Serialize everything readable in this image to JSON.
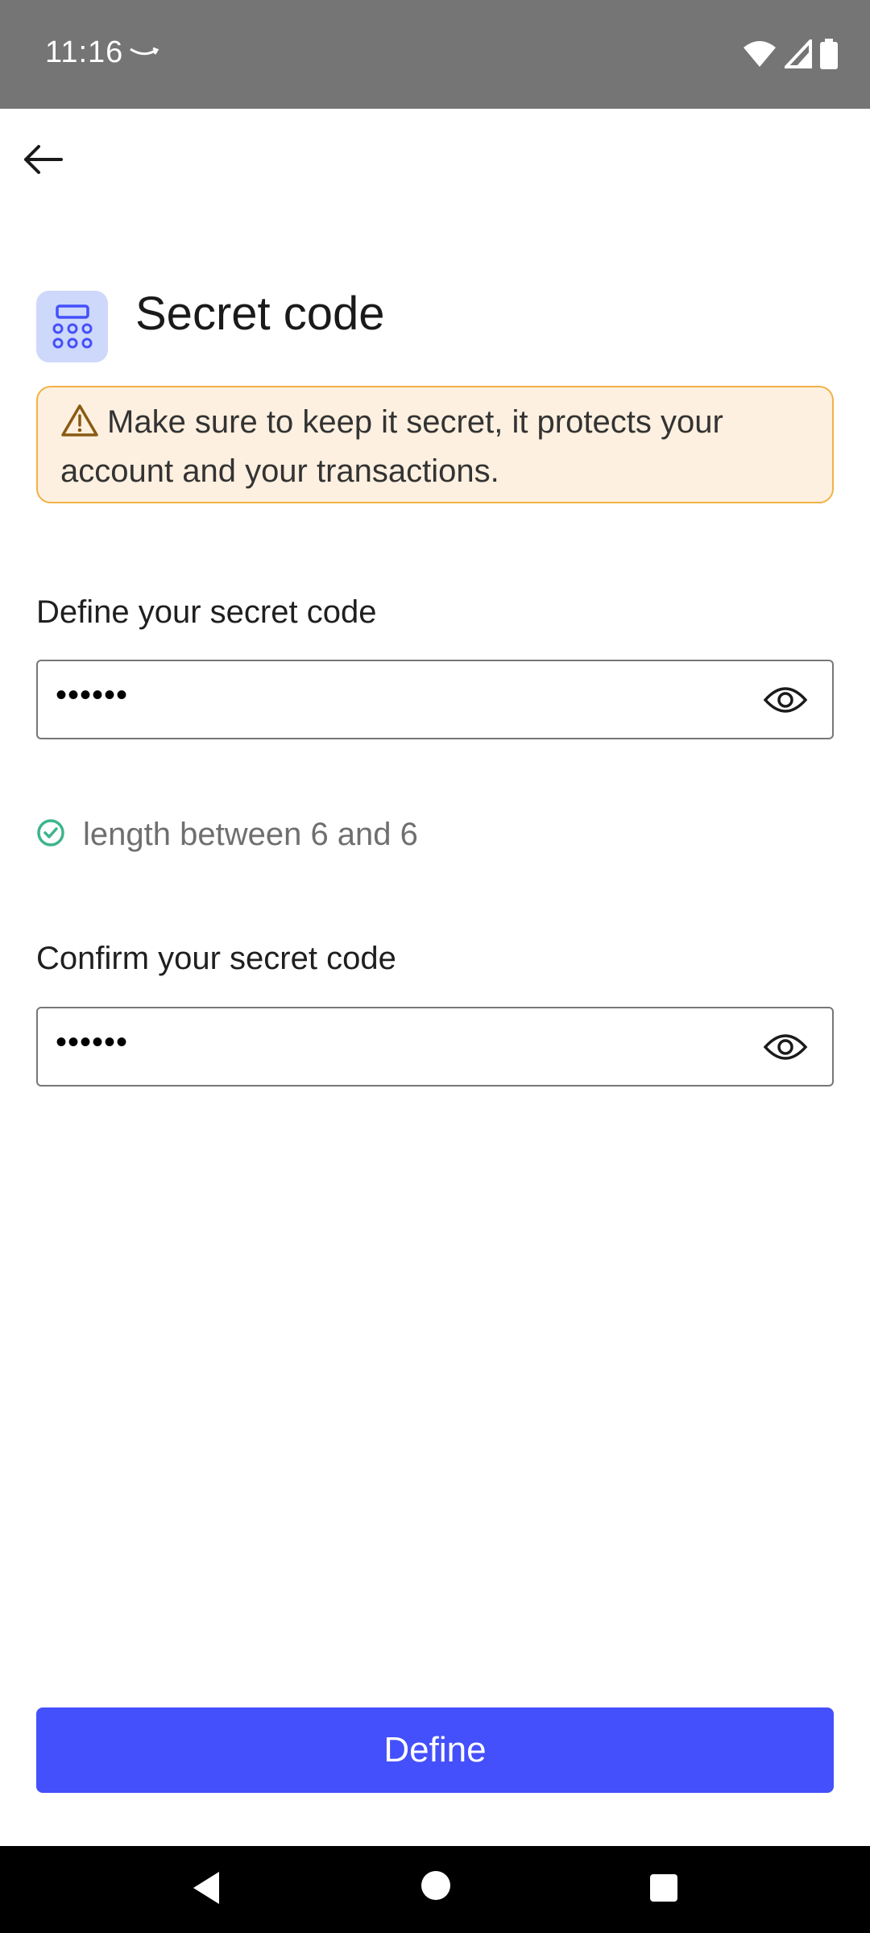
{
  "status_bar": {
    "time": "11:16",
    "icons": [
      "amazon-icon",
      "wifi-icon",
      "signal-icon",
      "battery-icon"
    ]
  },
  "header": {
    "title": "Secret code",
    "icon": "keypad-icon"
  },
  "warning": {
    "icon": "warning-triangle-icon",
    "text": "Make sure to keep it secret, it protects your account and your transactions."
  },
  "form": {
    "define": {
      "label": "Define your secret code",
      "value": "••••••",
      "toggle_icon": "eye-icon"
    },
    "rule": {
      "icon": "check-circle-icon",
      "text": "length between 6 and 6"
    },
    "confirm": {
      "label": "Confirm your secret code",
      "value": "••••••",
      "toggle_icon": "eye-icon"
    }
  },
  "actions": {
    "define_label": "Define"
  },
  "nav_bar": {
    "icons": [
      "back-icon",
      "home-icon",
      "recents-icon"
    ]
  },
  "colors": {
    "primary": "#4450FB",
    "warning_border": "#F2B145",
    "warning_bg": "#FDF0E0",
    "success": "#3DB48E",
    "icon_box_bg": "#CDD8FA"
  }
}
